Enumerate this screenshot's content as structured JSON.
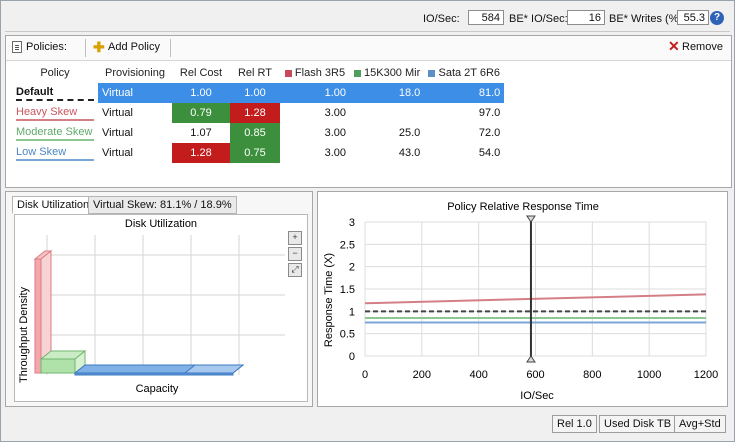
{
  "stats": {
    "io_label": "IO/Sec:",
    "io_value": "584",
    "be_io_label": "BE* IO/Sec:",
    "be_io_value": "16",
    "be_writes_label": "BE* Writes (%):",
    "be_writes_value": "55.3",
    "help_icon": "?"
  },
  "toolbar": {
    "policies_label": "Policies:",
    "add_label": "Add Policy",
    "remove_label": "Remove"
  },
  "table": {
    "headers": [
      "Policy",
      "Provisioning",
      "Rel Cost",
      "Rel RT",
      "Flash 3R5",
      "15K300 Mir",
      "Sata 2T 6R6"
    ],
    "tier_colors": [
      "#c84a5a",
      "#4f9e5c",
      "#5a8fc8"
    ],
    "rows": [
      {
        "name": "Default",
        "provisioning": "Virtual",
        "rel_cost": "1.00",
        "rel_rt": "1.00",
        "flash": "1.00",
        "mir": "18.0",
        "sata": "81.0",
        "line_color": "#222222"
      },
      {
        "name": "Heavy Skew",
        "provisioning": "Virtual",
        "rel_cost": "0.79",
        "rel_rt": "1.28",
        "flash": "3.00",
        "mir": "",
        "sata": "97.0",
        "line_color": "#d47f86"
      },
      {
        "name": "Moderate Skew",
        "provisioning": "Virtual",
        "rel_cost": "1.07",
        "rel_rt": "0.85",
        "flash": "3.00",
        "mir": "25.0",
        "sata": "72.0",
        "line_color": "#8cc793"
      },
      {
        "name": "Low Skew",
        "provisioning": "Virtual",
        "rel_cost": "1.28",
        "rel_rt": "0.75",
        "flash": "3.00",
        "mir": "43.0",
        "sata": "54.0",
        "line_color": "#7aa7d6"
      }
    ]
  },
  "disk": {
    "tabs": [
      "Disk Utilization",
      "Virtual Skew: 81.1% / 18.9%"
    ],
    "title": "Disk Utilization",
    "ylabel": "Throughput Density",
    "xlabel": "Capacity",
    "zoom_icons": [
      "zoom-in-icon",
      "zoom-out-icon",
      "zoom-fit-icon"
    ]
  },
  "chart_data": {
    "type": "line",
    "title": "Policy Relative Response Time",
    "xlabel": "IO/Sec",
    "ylabel": "Response Time (X)",
    "xlim": [
      0,
      1200
    ],
    "ylim": [
      0,
      3
    ],
    "xticks": [
      0,
      200,
      400,
      600,
      800,
      1000,
      1200
    ],
    "yticks": [
      0,
      0.5,
      1,
      1.5,
      2,
      2.5,
      3
    ],
    "marker_x": 584,
    "series": [
      {
        "name": "Default",
        "x": [
          0,
          1200
        ],
        "y": [
          1.0,
          1.0
        ],
        "color": "#444444",
        "dash": true
      },
      {
        "name": "Heavy Skew",
        "x": [
          0,
          1200
        ],
        "y": [
          1.18,
          1.38
        ],
        "color": "#d47f86",
        "dash": false
      },
      {
        "name": "Moderate Skew",
        "x": [
          0,
          1200
        ],
        "y": [
          0.85,
          0.85
        ],
        "color": "#8cc793",
        "dash": false
      },
      {
        "name": "Low Skew",
        "x": [
          0,
          1200
        ],
        "y": [
          0.75,
          0.75
        ],
        "color": "#7aa7d6",
        "dash": false
      }
    ]
  },
  "status": {
    "rel": "Rel 1.0",
    "used_disk": "Used Disk TB",
    "avg": "Avg+Std"
  }
}
